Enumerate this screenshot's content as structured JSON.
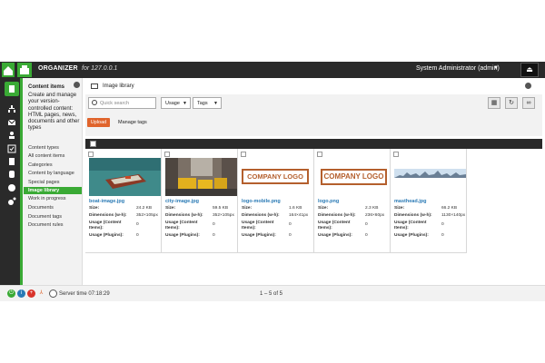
{
  "topbar": {
    "app_name": "ORGANIZER",
    "host": "for 127.0.0.1",
    "user": "System Administrator (admin)",
    "user_caret": "▼",
    "eject_glyph": "⏏"
  },
  "nav": {
    "heading": "Content items",
    "description": "Create and manage your version-controlled content: HTML pages, news, documents and other types",
    "items": [
      {
        "label": "Content types"
      },
      {
        "label": "All content items"
      },
      {
        "label": "Categories"
      },
      {
        "label": "Content by language"
      },
      {
        "label": "Special pages"
      },
      {
        "label": "Image library"
      },
      {
        "label": "Work in progress"
      },
      {
        "label": "Documents"
      },
      {
        "label": "Document tags"
      },
      {
        "label": "Document rules"
      }
    ],
    "active_index": 5
  },
  "main": {
    "breadcrumb": "Image library",
    "search_placeholder": "Quick search",
    "filters": [
      {
        "label": "Usage",
        "caret": "▼"
      },
      {
        "label": "Tags",
        "caret": "▼"
      }
    ],
    "toolbar_icons": [
      {
        "name": "grid-view-icon",
        "glyph": "▦"
      },
      {
        "name": "refresh-icon",
        "glyph": "↻"
      },
      {
        "name": "view-glasses-icon",
        "glyph": "∞"
      }
    ],
    "upload_label": "Upload",
    "manage_tags_label": "Manage tags"
  },
  "cards": [
    {
      "name": "boat-image.jpg",
      "size": "24.2 KB",
      "dimensions": "352×105px",
      "usage_content": "0",
      "usage_plugins": "0",
      "thumb": "boat"
    },
    {
      "name": "city-image.jpg",
      "size": "59.5 KB",
      "dimensions": "352×105px",
      "usage_content": "0",
      "usage_plugins": "0",
      "thumb": "city"
    },
    {
      "name": "logo-mobile.png",
      "size": "1.6 KB",
      "dimensions": "164×41px",
      "usage_content": "0",
      "usage_plugins": "0",
      "thumb": "logo",
      "logo_text": "COMPANY LOGO"
    },
    {
      "name": "logo.png",
      "size": "2.3 KB",
      "dimensions": "236×60px",
      "usage_content": "0",
      "usage_plugins": "0",
      "thumb": "logo",
      "logo_text": "COMPANY LOGO"
    },
    {
      "name": "masthead.jpg",
      "size": "66.2 KB",
      "dimensions": "1130×140px",
      "usage_content": "0",
      "usage_plugins": "0",
      "thumb": "masthead"
    }
  ],
  "card_labels": {
    "size": "Size:",
    "dimensions": "Dimensions (w-h):",
    "usage_content": "Usage (Content Items):",
    "usage_plugins": "Usage (Plugins):"
  },
  "bottom": {
    "server_time": "Server time 07:18:29",
    "pager": "1 – 5 of 5"
  },
  "colors": {
    "accent_green": "#3aaa35",
    "dark": "#2a2a2a",
    "upload_orange": "#e0642c",
    "link_blue": "#2a7ab5",
    "logo_brown": "#b45f2d"
  }
}
